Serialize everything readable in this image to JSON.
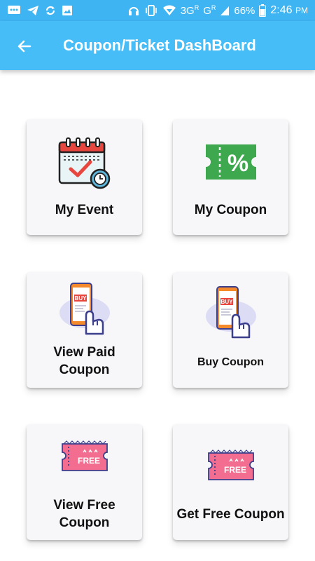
{
  "status_bar": {
    "network_3g": "3G",
    "network_g": "G",
    "roaming_mark": "R",
    "battery": "66%",
    "time": "2:46",
    "ampm": "PM",
    "icons": [
      "messages-icon",
      "telegram-icon",
      "sync-icon",
      "image-icon",
      "headset-icon",
      "vibrate-icon",
      "wifi-icon",
      "signal-icon",
      "battery-icon"
    ]
  },
  "app_bar": {
    "title": "Coupon/Ticket DashBoard",
    "back_icon": "arrow-left-icon"
  },
  "cards": [
    {
      "label": "My Event",
      "icon": "calendar-event-icon"
    },
    {
      "label": "My Coupon",
      "icon": "percent-coupon-icon"
    },
    {
      "label": "View Paid Coupon",
      "icon": "phone-buy-icon"
    },
    {
      "label": "Buy Coupon",
      "icon": "phone-buy-icon"
    },
    {
      "label": "View Free Coupon",
      "icon": "free-ticket-icon"
    },
    {
      "label": "Get Free Coupon",
      "icon": "free-ticket-icon"
    }
  ],
  "icon_text": {
    "buy": "BUY",
    "free": "FREE",
    "percent": "%"
  },
  "colors": {
    "status_bar": "#3fb4f3",
    "app_bar": "#46bdf7",
    "card_bg": "#f7f7f9",
    "coupon_green": "#3ea84f",
    "calendar_red": "#e8473f",
    "ticket_pink": "#f26d8f",
    "phone_orange": "#f58a2c",
    "hand_purple": "#3b3f8c"
  }
}
